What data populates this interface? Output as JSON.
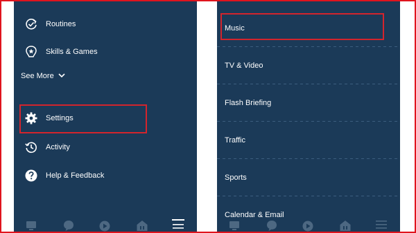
{
  "left": {
    "menu": [
      {
        "label": "Routines",
        "icon": "routines-icon"
      },
      {
        "label": "Skills & Games",
        "icon": "skills-icon"
      }
    ],
    "see_more": "See More",
    "settings": {
      "label": "Settings",
      "icon": "gear-icon"
    },
    "menu2": [
      {
        "label": "Activity",
        "icon": "history-icon"
      },
      {
        "label": "Help & Feedback",
        "icon": "help-icon"
      }
    ]
  },
  "right": {
    "items": [
      "Music",
      "TV & Video",
      "Flash Briefing",
      "Traffic",
      "Sports",
      "Calendar & Email"
    ]
  },
  "colors": {
    "panel": "#1b3a58",
    "highlight": "#d4242c",
    "frame": "#e0141e"
  }
}
